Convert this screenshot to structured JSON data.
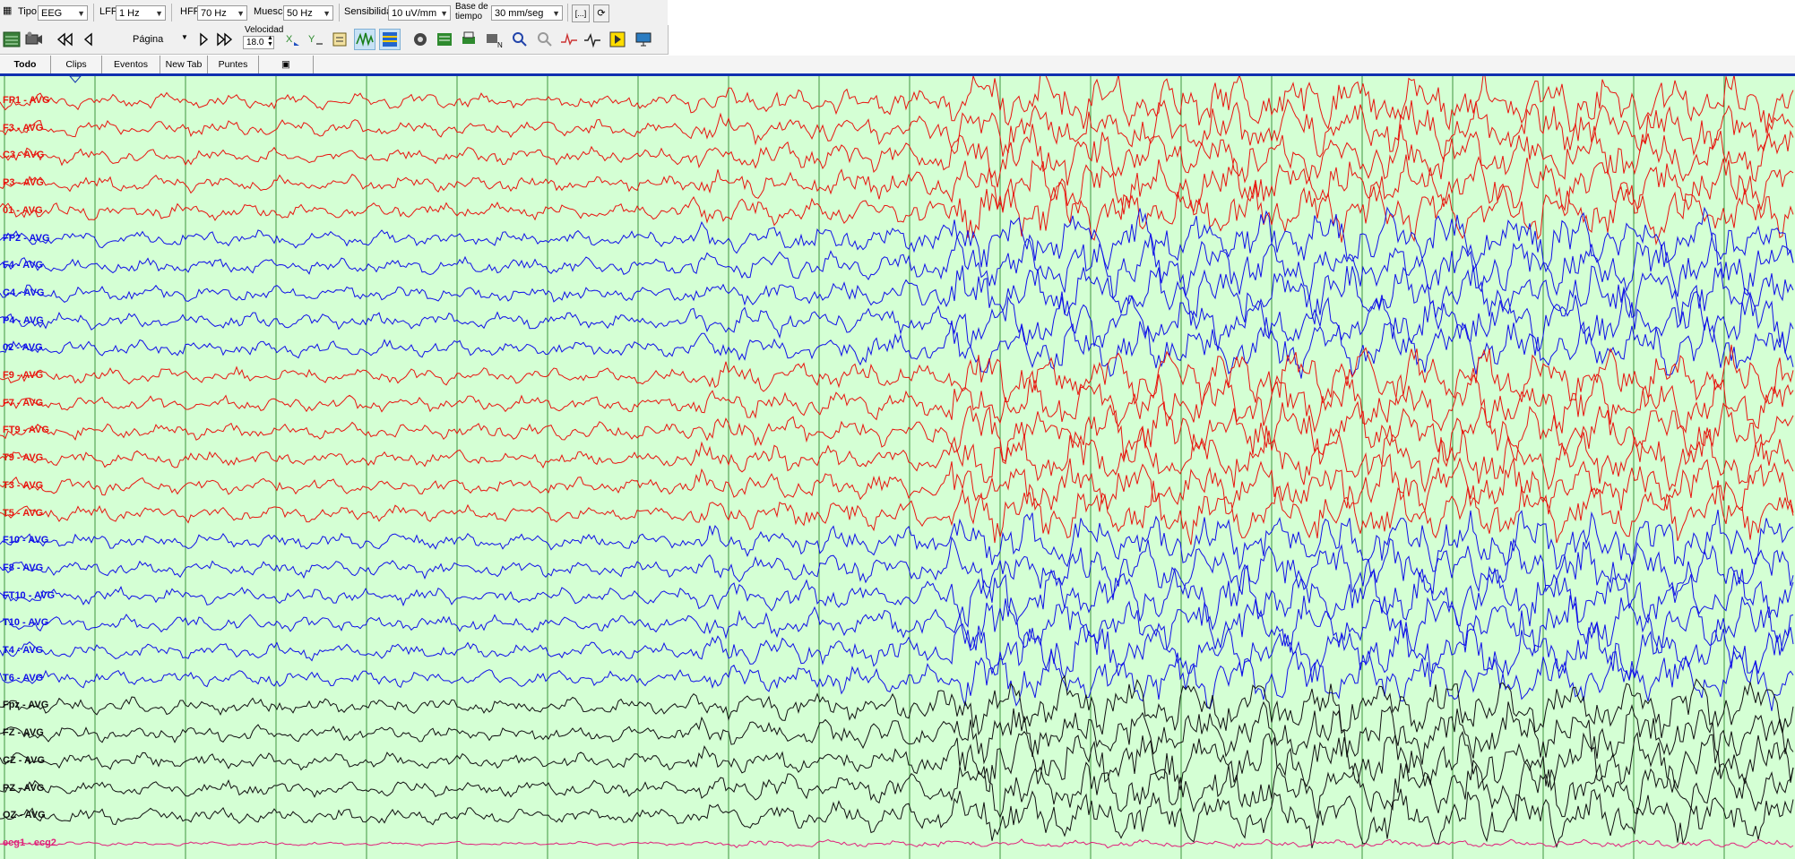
{
  "toolbar": {
    "tipo_label": "Tipo",
    "tipo_value": "EEG",
    "lff_label": "LFF",
    "lff_value": "1 Hz",
    "hff_label": "HFF",
    "hff_value": "70 Hz",
    "muesca_label": "Muesca",
    "muesca_value": "50 Hz",
    "sensibilidad_label": "Sensibilidad",
    "sensibilidad_value": "10 uV/mm",
    "base_label_1": "Base de",
    "base_label_2": "tiempo",
    "base_value": "30 mm/seg",
    "bracket_btn": "[...]",
    "pagina_label": "Página",
    "velocidad_label": "Velocidad",
    "velocidad_value": "18.0"
  },
  "icons": [
    "montage-icon",
    "video-icon",
    "first-page-icon",
    "prev-page-icon",
    "next-page-icon",
    "last-page-icon",
    "cursor-x-icon",
    "cursor-y-icon",
    "marker-icon",
    "waveform-overlay-icon",
    "display-grid-icon",
    "camera-settings-icon",
    "montage-edit-icon",
    "print-icon",
    "notch-icon",
    "zoom-in-icon",
    "zoom-out-icon",
    "spike-icon",
    "wave-detect-icon",
    "event-flag-icon",
    "monitor-icon"
  ],
  "tabs": [
    {
      "label": "Todo",
      "active": true
    },
    {
      "label": "Clips",
      "active": false
    },
    {
      "label": "Eventos",
      "active": false
    },
    {
      "label": "New Tab",
      "active": false
    },
    {
      "label": "Puntes",
      "active": false
    }
  ],
  "channels": [
    {
      "label": "FP1 - AVG",
      "color": "#e8150f"
    },
    {
      "label": "F3 - AVG",
      "color": "#e8150f"
    },
    {
      "label": "C3 - AVG",
      "color": "#e8150f"
    },
    {
      "label": "P3 - AVG",
      "color": "#e8150f"
    },
    {
      "label": "01 - AVG",
      "color": "#e8150f"
    },
    {
      "label": "FP2 - AVG",
      "color": "#1010e8"
    },
    {
      "label": "F4 - AVG",
      "color": "#1010e8"
    },
    {
      "label": "C4 - AVG",
      "color": "#1010e8"
    },
    {
      "label": "P4 - AVG",
      "color": "#1010e8"
    },
    {
      "label": "02 - AVG",
      "color": "#1010e8"
    },
    {
      "label": "F9 - AVG",
      "color": "#e8150f"
    },
    {
      "label": "F7 - AVG",
      "color": "#e8150f"
    },
    {
      "label": "FT9 - AVG",
      "color": "#e8150f"
    },
    {
      "label": "T9 - AVG",
      "color": "#e8150f"
    },
    {
      "label": "T3 - AVG",
      "color": "#e8150f"
    },
    {
      "label": "T5 - AVG",
      "color": "#e8150f"
    },
    {
      "label": "F10 - AVG",
      "color": "#1010e8"
    },
    {
      "label": "F8 - AVG",
      "color": "#1010e8"
    },
    {
      "label": "FT10 - AVG",
      "color": "#1010e8"
    },
    {
      "label": "T10 - AVG",
      "color": "#1010e8"
    },
    {
      "label": "T4 - AVG",
      "color": "#1010e8"
    },
    {
      "label": "T6 - AVG",
      "color": "#1010e8"
    },
    {
      "label": "Fpz - AVG",
      "color": "#111111"
    },
    {
      "label": "FZ - AVG",
      "color": "#111111"
    },
    {
      "label": "CZ - AVG",
      "color": "#111111"
    },
    {
      "label": "PZ - AVG",
      "color": "#111111"
    },
    {
      "label": "OZ - AVG",
      "color": "#111111"
    },
    {
      "label": "ecg1 - ecg2",
      "color": "#e0207a"
    }
  ],
  "colors": {
    "background": "#d4ffd4",
    "gridline": "#1a7a1a",
    "tab_underline": "#1030b0"
  }
}
